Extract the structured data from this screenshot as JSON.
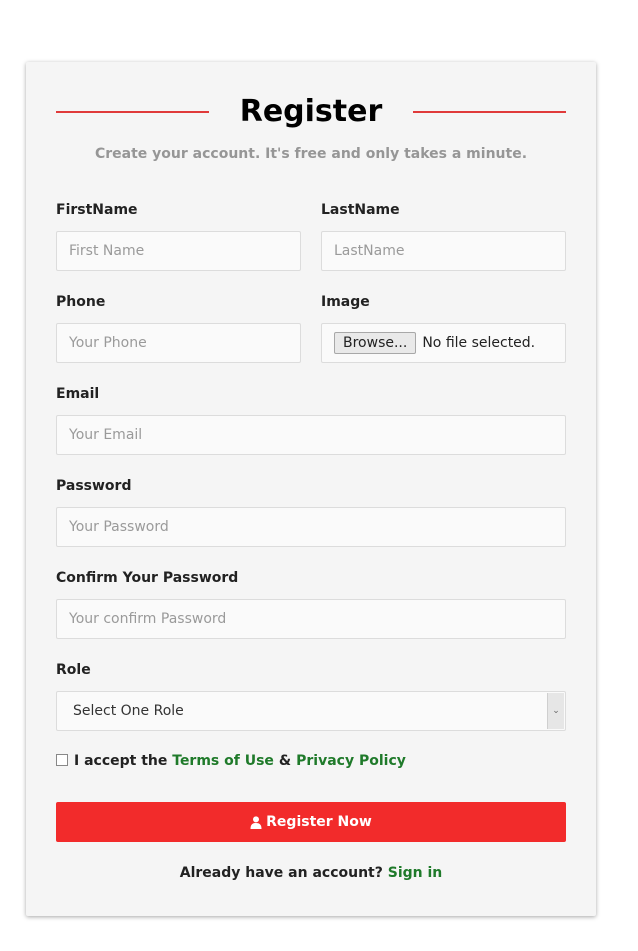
{
  "form": {
    "title": "Register",
    "subtitle": "Create your account. It's free and only takes a minute.",
    "fields": {
      "first_name": {
        "label": "FirstName",
        "placeholder": "First Name"
      },
      "last_name": {
        "label": "LastName",
        "placeholder": "LastName"
      },
      "phone": {
        "label": "Phone",
        "placeholder": "Your Phone"
      },
      "image": {
        "label": "Image",
        "browse_label": "Browse...",
        "status": "No file selected."
      },
      "email": {
        "label": "Email",
        "placeholder": "Your Email"
      },
      "password": {
        "label": "Password",
        "placeholder": "Your Password"
      },
      "confirm_password": {
        "label": "Confirm Your Password",
        "placeholder": "Your confirm Password"
      },
      "role": {
        "label": "Role",
        "selected": "Select One Role"
      }
    },
    "terms": {
      "prefix": "I accept the",
      "terms_link": "Terms of Use",
      "separator": "&",
      "privacy_link": "Privacy Policy"
    },
    "submit_label": "Register Now",
    "submit_icon": "user-icon",
    "footer": {
      "prompt": "Already have an account?",
      "signin_link": "Sign in"
    }
  },
  "colors": {
    "accent_red": "#f22b2b",
    "divider_red": "#e03a3a",
    "link_green": "#1f7a2a",
    "card_bg": "#f5f5f5"
  }
}
